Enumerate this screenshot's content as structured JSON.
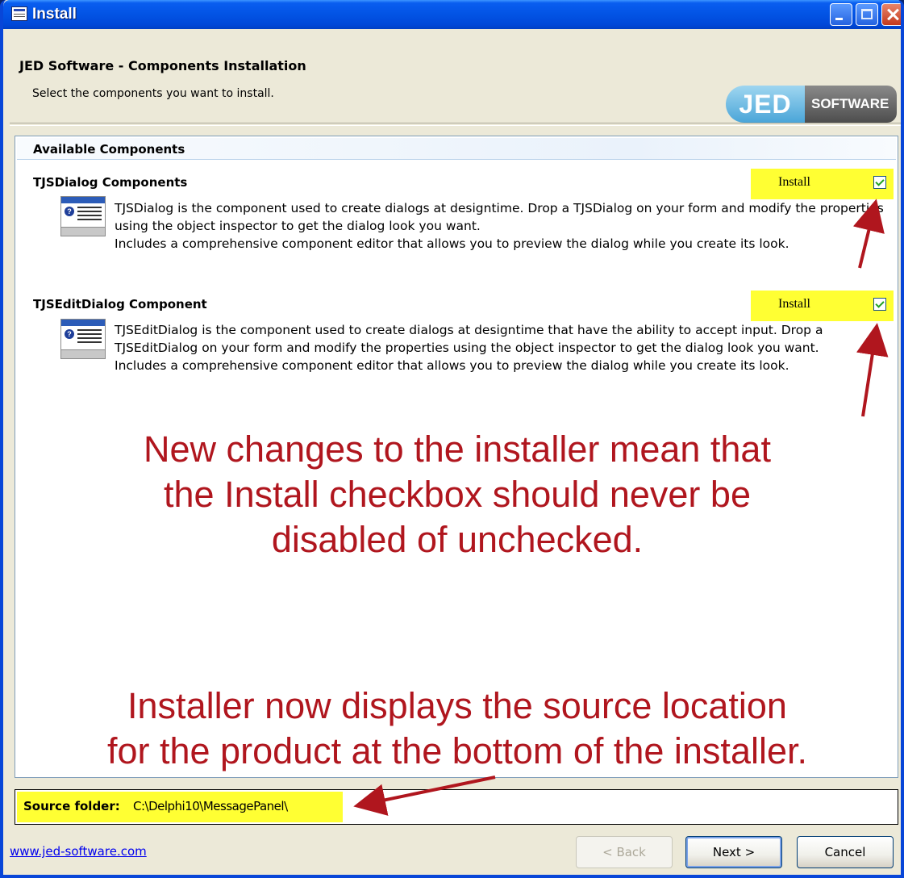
{
  "window": {
    "title": "Install"
  },
  "header": {
    "title": "JED Software - Components Installation",
    "subtitle": "Select the components you want to install.",
    "logo_left": "JED",
    "logo_right": "SOFTWARE"
  },
  "panel": {
    "heading": "Available Components",
    "components": [
      {
        "title": "TJSDialog Components",
        "install_label": "Install",
        "checked": true,
        "desc1": "TJSDialog is the component used to create dialogs at designtime. Drop a TJSDialog on your form and modify the properties using the object inspector to get the dialog look you want.",
        "desc2": "Includes a comprehensive component editor that allows you to preview the dialog while you create its look."
      },
      {
        "title": "TJSEditDialog Component",
        "install_label": "Install",
        "checked": true,
        "desc1": "TJSEditDialog is the component used to create dialogs at designtime that have the ability to accept input. Drop a TJSEditDialog on your form and modify the properties using the object inspector to get the dialog look you want.",
        "desc2": "Includes a comprehensive component editor that allows you to preview the dialog while you create its look."
      }
    ]
  },
  "annotations": {
    "note1_line1": "New changes to the installer mean that",
    "note1_line2": "the Install checkbox should never be",
    "note1_line3": "disabled of unchecked.",
    "note2_line1": "Installer now displays the source location",
    "note2_line2": "for the product at the bottom of the installer."
  },
  "source": {
    "label": "Source folder:",
    "value": "C:\\Delphi10\\MessagePanel\\"
  },
  "footer": {
    "link": "www.jed-software.com",
    "back": "< Back",
    "next": "Next >",
    "cancel": "Cancel"
  },
  "colors": {
    "highlight": "#FFFF33",
    "annotation": "#B0161E",
    "title_bar": "#0253E4"
  }
}
